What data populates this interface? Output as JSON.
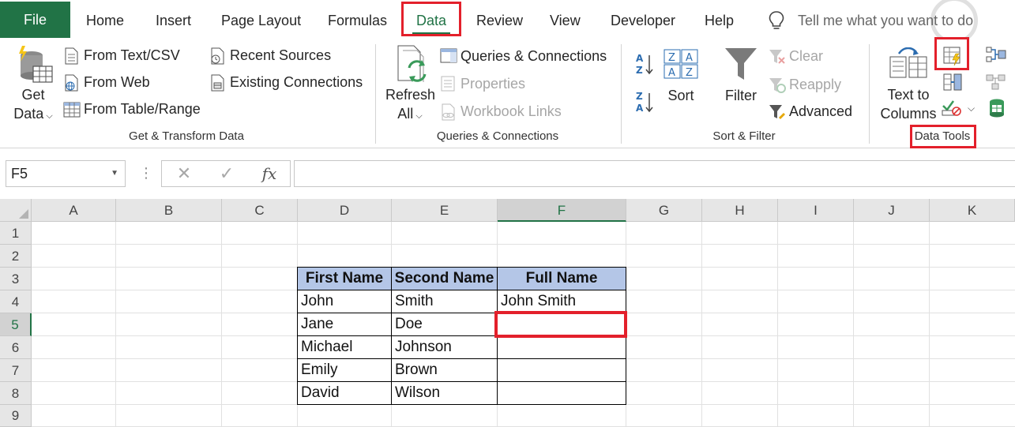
{
  "tabs": {
    "file": "File",
    "home": "Home",
    "insert": "Insert",
    "page_layout": "Page Layout",
    "formulas": "Formulas",
    "data": "Data",
    "review": "Review",
    "view": "View",
    "developer": "Developer",
    "help": "Help",
    "tell_me": "Tell me what you want to do"
  },
  "ribbon": {
    "get_transform": {
      "get_data_line1": "Get",
      "get_data_line2": "Data",
      "from_text_csv": "From Text/CSV",
      "from_web": "From Web",
      "from_table_range": "From Table/Range",
      "recent_sources": "Recent Sources",
      "existing_connections": "Existing Connections",
      "label": "Get & Transform Data"
    },
    "queries": {
      "refresh_line1": "Refresh",
      "refresh_line2": "All",
      "queries_connections": "Queries & Connections",
      "properties": "Properties",
      "workbook_links": "Workbook Links",
      "label": "Queries & Connections"
    },
    "sort_filter": {
      "sort": "Sort",
      "filter": "Filter",
      "clear": "Clear",
      "reapply": "Reapply",
      "advanced": "Advanced",
      "label": "Sort & Filter"
    },
    "data_tools": {
      "text_to_columns_line1": "Text to",
      "text_to_columns_line2": "Columns",
      "label": "Data Tools"
    }
  },
  "formula_bar": {
    "name_box": "F5",
    "cancel": "✕",
    "enter": "✓",
    "fx": "fx",
    "formula": ""
  },
  "sheet": {
    "columns": [
      "A",
      "B",
      "C",
      "D",
      "E",
      "F",
      "G",
      "H",
      "I",
      "J",
      "K"
    ],
    "rows": [
      "1",
      "2",
      "3",
      "4",
      "5",
      "6",
      "7",
      "8",
      "9"
    ],
    "active_cell": "F5",
    "table": {
      "headers": [
        "First Name",
        "Second Name",
        "Full Name"
      ],
      "rows": [
        [
          "John",
          "Smith",
          "John Smith"
        ],
        [
          "Jane",
          "Doe",
          ""
        ],
        [
          "Michael",
          "Johnson",
          ""
        ],
        [
          "Emily",
          "Brown",
          ""
        ],
        [
          "David",
          "Wilson",
          ""
        ]
      ]
    }
  },
  "colors": {
    "excel_green": "#217346",
    "highlight_red": "#e3202b",
    "table_header_fill": "#b4c6e7"
  }
}
